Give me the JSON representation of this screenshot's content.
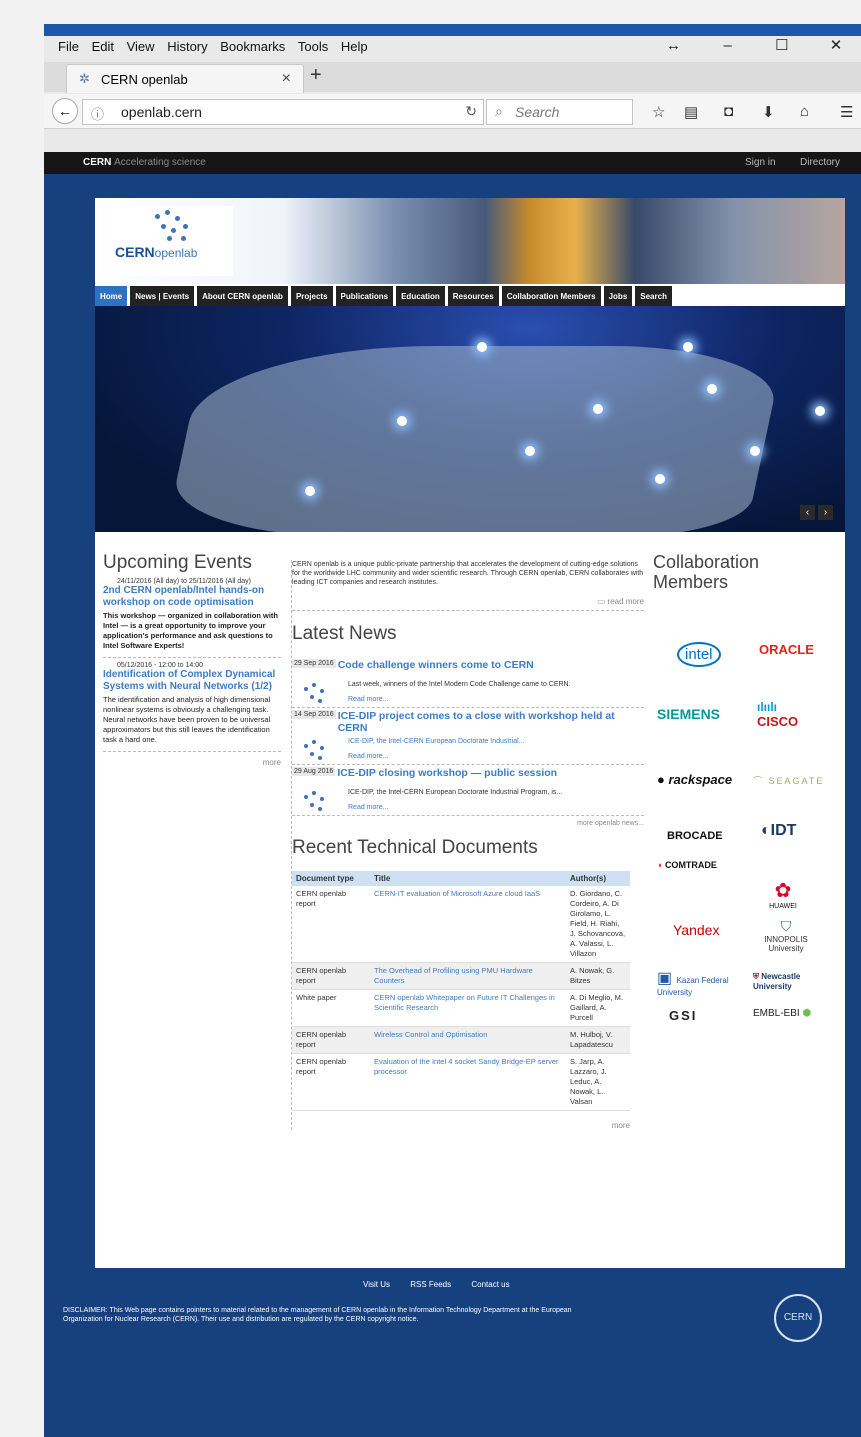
{
  "browser": {
    "menu": [
      "File",
      "Edit",
      "View",
      "History",
      "Bookmarks",
      "Tools",
      "Help"
    ],
    "window_buttons": [
      "↔",
      "–",
      "☐",
      "✕"
    ],
    "tab_title": "CERN openlab",
    "tab_close": "×",
    "new_tab": "+",
    "url": "openlab.cern",
    "search_placeholder": "Search"
  },
  "topbar": {
    "brand": "CERN",
    "tagline": "Accelerating science",
    "sign_in": "Sign in",
    "directory": "Directory"
  },
  "header": {
    "logo_text": "CERN",
    "logo_sub": "openlab"
  },
  "nav": [
    "Home",
    "News | Events",
    "About CERN openlab",
    "Projects",
    "Publications",
    "Education",
    "Resources",
    "Collaboration Members",
    "Jobs",
    "Search"
  ],
  "hero": {
    "prev": "‹",
    "next": "›"
  },
  "events": {
    "title": "Upcoming Events",
    "items": [
      {
        "date": "24/11/2016 (All day) to 25/11/2016 (All day)",
        "title": "2nd CERN openlab/Intel hands-on workshop on code optimisation",
        "body": "This workshop — organized in collaboration with Intel — is a great opportunity to improve your application's performance and ask questions to Intel Software Experts!"
      },
      {
        "date": "05/12/2016 - 12:00 to 14:00",
        "title": "Identification of Complex Dynamical Systems with Neural Networks (1/2)",
        "body": "The identification and analysis of high dimensional nonlinear systems is obviously a challenging task. Neural networks have been proven to be universal approximators but this still leaves the identification task a hard one."
      }
    ],
    "more": "more"
  },
  "intro": {
    "text": "CERN openlab is a unique public-private partnership that accelerates the development of cutting-edge solutions for the worldwide LHC community and wider scientific research. Through CERN openlab, CERN collaborates with leading ICT companies and research institutes.",
    "read_more": "read more"
  },
  "news": {
    "title": "Latest News",
    "items": [
      {
        "date": "29 Sep 2016",
        "title": "Code challenge winners come to CERN",
        "summary": "Last week, winners of the Intel Modern Code Challenge came to CERN.",
        "read_more": "Read more..."
      },
      {
        "date": "14 Sep 2016",
        "title": "ICE-DIP project comes to a close with workshop held at CERN",
        "summary": "ICE-DIP, the Intel-CERN European Doctorate Industrial...",
        "read_more": "Read more..."
      },
      {
        "date": "29 Aug 2016",
        "title": "ICE-DIP closing workshop — public session",
        "summary": "ICE-DIP, the Intel-CERN European Doctorate Industrial Program, is...",
        "read_more": "Read more..."
      }
    ],
    "more": "more openlab news..."
  },
  "docs": {
    "title": "Recent Technical Documents",
    "columns": [
      "Document type",
      "Title",
      "Author(s)"
    ],
    "rows": [
      [
        "CERN openlab report",
        "CERN-IT evaluation of Microsoft Azure cloud IaaS",
        "D. Giordano, C. Cordeiro, A. Di Girolamo, L. Field, H. Riahi, J. Schovancova, A. Valassi, L. Villazon"
      ],
      [
        "CERN openlab report",
        "The Overhead of Profiling using PMU Hardware Counters",
        "A. Nowak, G. Bitzes"
      ],
      [
        "White paper",
        "CERN openlab Whitepaper on Future IT Challenges in Scientific Research",
        "A. Di Meglio, M. Gaillard, A. Purcell"
      ],
      [
        "CERN openlab report",
        "Wireless Control and Optimisation",
        "M. Hulboj, V. Lapadatescu"
      ],
      [
        "CERN openlab report",
        "Evaluation of the Intel 4 socket Sandy Bridge-EP server processor",
        "S. Jarp, A. Lazzaro, J. Leduc, A. Nowak, L. Valsan"
      ]
    ],
    "more": "more"
  },
  "collab": {
    "title": "Collaboration Members",
    "logos": [
      "intel",
      "ORACLE",
      "SIEMENS",
      "cisco",
      "rackspace",
      "SEAGATE",
      "BROCADE",
      "IDT",
      "COMTRADE",
      "HUAWEI",
      "Yandex",
      "INNOPOLIS University",
      "Kazan Federal University",
      "Newcastle University",
      "GSI",
      "EMBL-EBI"
    ],
    "logo_colors": {
      "intel": "#0071c5",
      "oracle": "#e2231a",
      "siemens": "#009999",
      "cisco": "#049fd9",
      "brocade": "#e2231a",
      "huawei": "#cf0a2c",
      "yandex": "#cc0000"
    }
  },
  "footer": {
    "links": [
      "Visit Us",
      "RSS Feeds",
      "Contact us"
    ],
    "disclaimer": "DISCLAIMER: This Web page contains pointers to material related to the management of CERN openlab in the Information Technology Department at the European Organization for Nuclear Research (CERN). Their use and distribution are regulated by the CERN copyright notice.",
    "logo": "CERN"
  }
}
